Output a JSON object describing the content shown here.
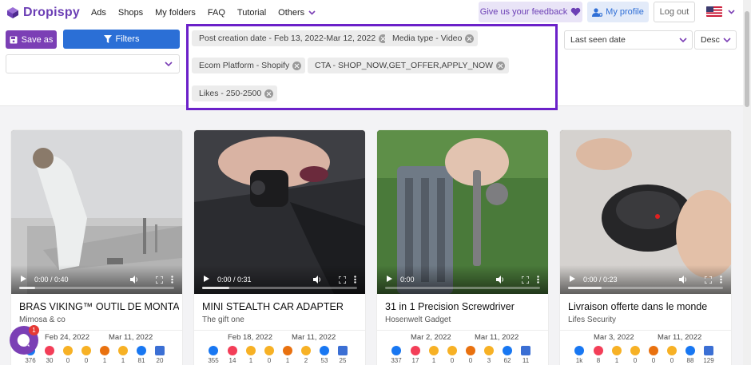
{
  "app": {
    "name": "Dropispy"
  },
  "nav": {
    "links": [
      "Ads",
      "Shops",
      "My folders",
      "FAQ",
      "Tutorial",
      "Others"
    ],
    "feedback_label": "Give us your feedback",
    "profile_label": "My profile",
    "logout_label": "Log out",
    "language": "English (US flag)"
  },
  "toolbar": {
    "save_label": "Save as",
    "filters_label": "Filters",
    "shop_select_value": "",
    "sort_value": "Last seen date",
    "sort_dir": "Desc"
  },
  "filters": [
    "Post creation date - Feb 13, 2022-Mar 12, 2022",
    "Media type - Video",
    "Ecom Platform - Shopify",
    "CTA - SHOP_NOW,GET_OFFER,APPLY_NOW",
    "Likes - 250-2500"
  ],
  "colors": {
    "brand": "#7b3fb5",
    "primary": "#2b6fd6",
    "highlight_border": "#6b21c9"
  },
  "cards": [
    {
      "title": "BRAS VIKING™ OUTIL DE MONTAGE",
      "shop": "Mimosa & co",
      "video_time": "0:00 / 0:40",
      "first_seen": "Feb 24, 2022",
      "last_seen": "Mar 11, 2022",
      "reactions": [
        "376",
        "30",
        "0",
        "0",
        "1",
        "1",
        "81",
        "20"
      ]
    },
    {
      "title": "MINI STEALTH CAR ADAPTER",
      "shop": "The gift one",
      "video_time": "0:00 / 0:31",
      "first_seen": "Feb 18, 2022",
      "last_seen": "Mar 11, 2022",
      "reactions": [
        "355",
        "14",
        "1",
        "0",
        "1",
        "2",
        "53",
        "25"
      ]
    },
    {
      "title": "31 in 1 Precision Screwdriver",
      "shop": "Hosenwelt Gadget",
      "video_time": "0:00",
      "first_seen": "Mar 2, 2022",
      "last_seen": "Mar 11, 2022",
      "reactions": [
        "337",
        "17",
        "1",
        "0",
        "0",
        "3",
        "62",
        "11"
      ]
    },
    {
      "title": "Livraison offerte dans le monde",
      "shop": "Lifes Security",
      "video_time": "0:00 / 0:23",
      "first_seen": "Mar 3, 2022",
      "last_seen": "Mar 11, 2022",
      "reactions": [
        "1k",
        "8",
        "1",
        "0",
        "0",
        "0",
        "88",
        "129"
      ]
    }
  ],
  "reaction_icons": [
    "like-icon",
    "love-icon",
    "haha-icon",
    "sad-icon",
    "angry-icon",
    "wow-icon",
    "share-icon",
    "comment-icon"
  ],
  "chat": {
    "badge": "1"
  }
}
